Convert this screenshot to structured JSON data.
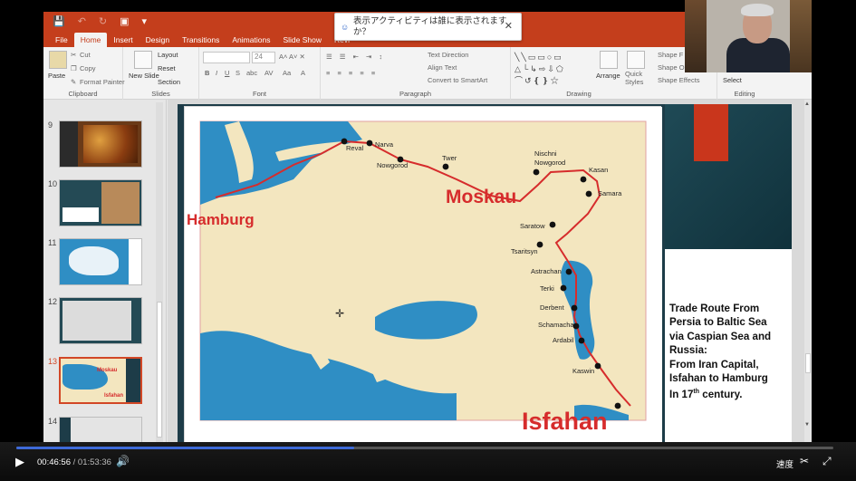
{
  "window": {
    "tabs": [
      {
        "label": "File"
      },
      {
        "label": "Home"
      },
      {
        "label": "Insert"
      },
      {
        "label": "Design"
      },
      {
        "label": "Transitions"
      },
      {
        "label": "Animations"
      },
      {
        "label": "Slide Show"
      },
      {
        "label": "Revi"
      }
    ],
    "active_tab": "Home"
  },
  "notification": {
    "text": "表示アクティビティは誰に表示されますか？"
  },
  "ribbon": {
    "clipboard": {
      "paste": "Paste",
      "cut": "Cut",
      "copy": "Copy",
      "format_painter": "Format Painter",
      "label": "Clipboard"
    },
    "slides": {
      "new_slide": "New Slide",
      "layout": "Layout",
      "reset": "Reset",
      "section": "Section",
      "label": "Slides"
    },
    "font": {
      "size": "24",
      "label": "Font"
    },
    "paragraph": {
      "text_direction": "Text Direction",
      "align_text": "Align Text",
      "convert_smartart": "Convert to SmartArt",
      "label": "Paragraph"
    },
    "drawing": {
      "arrange": "Arrange",
      "quick_styles": "Quick Styles",
      "shape_fill": "Shape F",
      "shape_outline": "Shape O",
      "shape_effects": "Shape Effects",
      "label": "Drawing"
    },
    "editing": {
      "select": "Select",
      "label": "Editing"
    }
  },
  "thumbnails": [
    {
      "number": "9"
    },
    {
      "number": "10"
    },
    {
      "number": "11"
    },
    {
      "number": "12"
    },
    {
      "number": "13",
      "selected": true
    },
    {
      "number": "14"
    }
  ],
  "thumbnail_13_labels": {
    "top": "Moskau",
    "bottom": "Isfahan"
  },
  "slide": {
    "caption_line1": "Trade Route From",
    "caption_line2": "Persia to Baltic Sea",
    "caption_line3": "via Caspian Sea and",
    "caption_line4": "Russia:",
    "caption_line5": "From Iran Capital,",
    "caption_line6": "Isfahan to Hamburg",
    "caption_line7_pre": "In 17",
    "caption_line7_sup": "th",
    "caption_line7_post": " century.",
    "map": {
      "big_labels": {
        "hamburg": "Hamburg",
        "moskau": "Moskau",
        "isfahan": "Isfahan"
      },
      "towns": {
        "reval": "Reval",
        "narva": "Narva",
        "nowgorod": "Nowgorod",
        "twer": "Twer",
        "nischni": "Nischni",
        "nischni2": "Nowgorod",
        "kasan": "Kasan",
        "samara": "Samara",
        "saratow": "Saratow",
        "tsaritsyn": "Tsaritsyn",
        "astrachan": "Astrachan",
        "terki": "Terki",
        "derbent": "Derbent",
        "schamacha": "Schamacha",
        "ardabil": "Ardabil",
        "kaswin": "Kaswin"
      }
    }
  },
  "player": {
    "current_time": "00:46:56",
    "separator": " / ",
    "total_time": "01:53:36",
    "speed_label": "速度",
    "progress_fraction": 0.413,
    "accent": "#3e6ad8"
  },
  "colors": {
    "office_accent": "#c43e1c",
    "route": "#d62c2c",
    "sea": "#2f8ec4",
    "land": "#f3e6bf"
  }
}
